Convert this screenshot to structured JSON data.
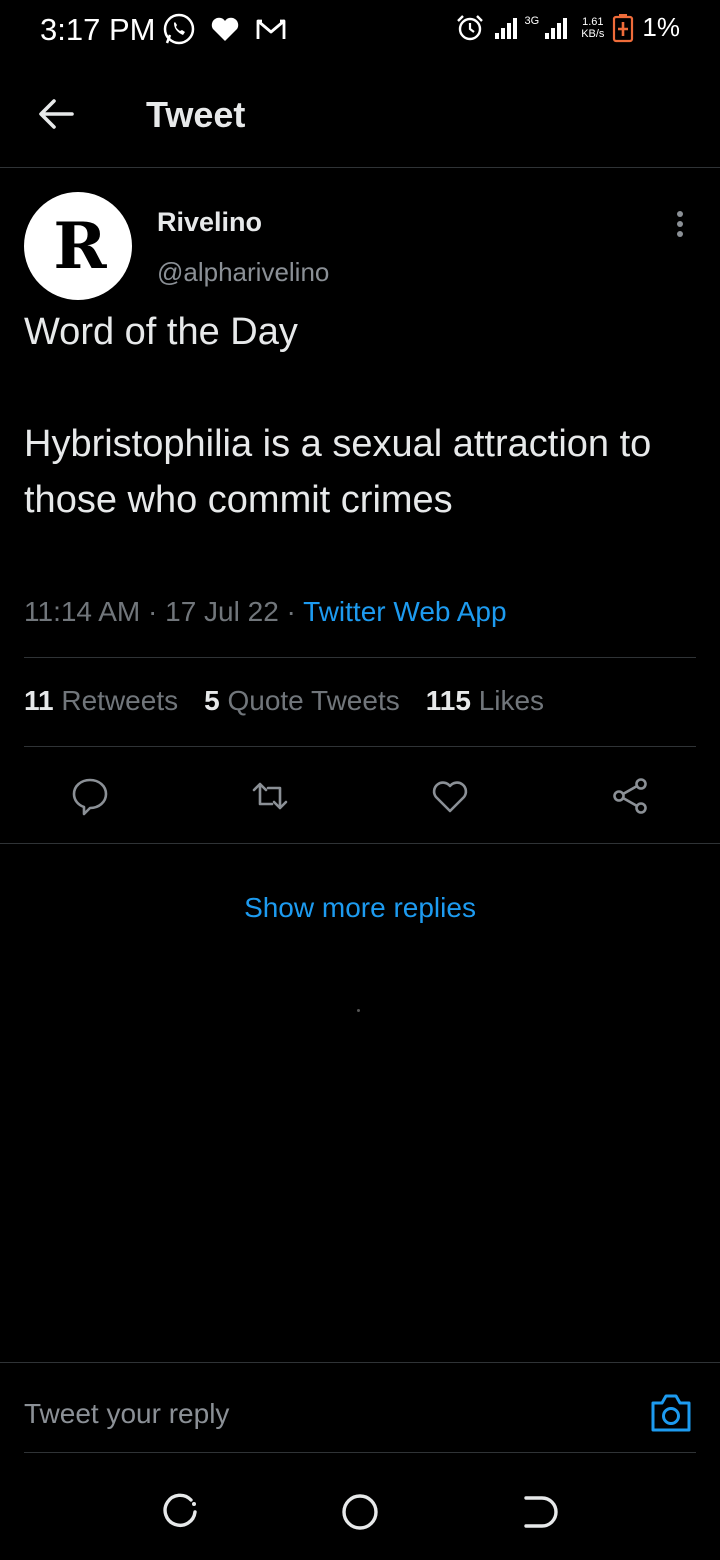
{
  "status_bar": {
    "time": "3:17 PM",
    "left_icons": [
      "whatsapp-icon",
      "heart-icon",
      "gmail-icon"
    ],
    "network_type": "3G",
    "net_speed_value": "1.61",
    "net_speed_unit": "KB/s",
    "battery_percent": "1%"
  },
  "header": {
    "title": "Tweet",
    "back_icon": "arrow-left-icon"
  },
  "tweet": {
    "author_name": "Rivelino",
    "author_handle": "@alpharivelino",
    "avatar_letter": "R",
    "text_lines": [
      "Word of the Day",
      "",
      "Hybristophilia is a sexual attraction to those who commit crimes"
    ],
    "time": "11:14 AM",
    "date": "17 Jul 22",
    "separator": "·",
    "source": "Twitter Web App"
  },
  "stats": {
    "retweets_count": "11",
    "retweets_label": "Retweets",
    "quotes_count": "5",
    "quotes_label": "Quote Tweets",
    "likes_count": "115",
    "likes_label": "Likes"
  },
  "actions": [
    "reply-icon",
    "retweet-icon",
    "like-icon",
    "share-icon"
  ],
  "show_more_replies": "Show more replies",
  "reply_bar": {
    "placeholder": "Tweet your reply",
    "camera_icon": "camera-icon"
  },
  "colors": {
    "background": "#000000",
    "accent": "#1d9bf0",
    "text": "#e7e9ea",
    "secondary_text": "#71767b",
    "divider": "#2f3336",
    "battery_low": "#ef6c3a"
  }
}
